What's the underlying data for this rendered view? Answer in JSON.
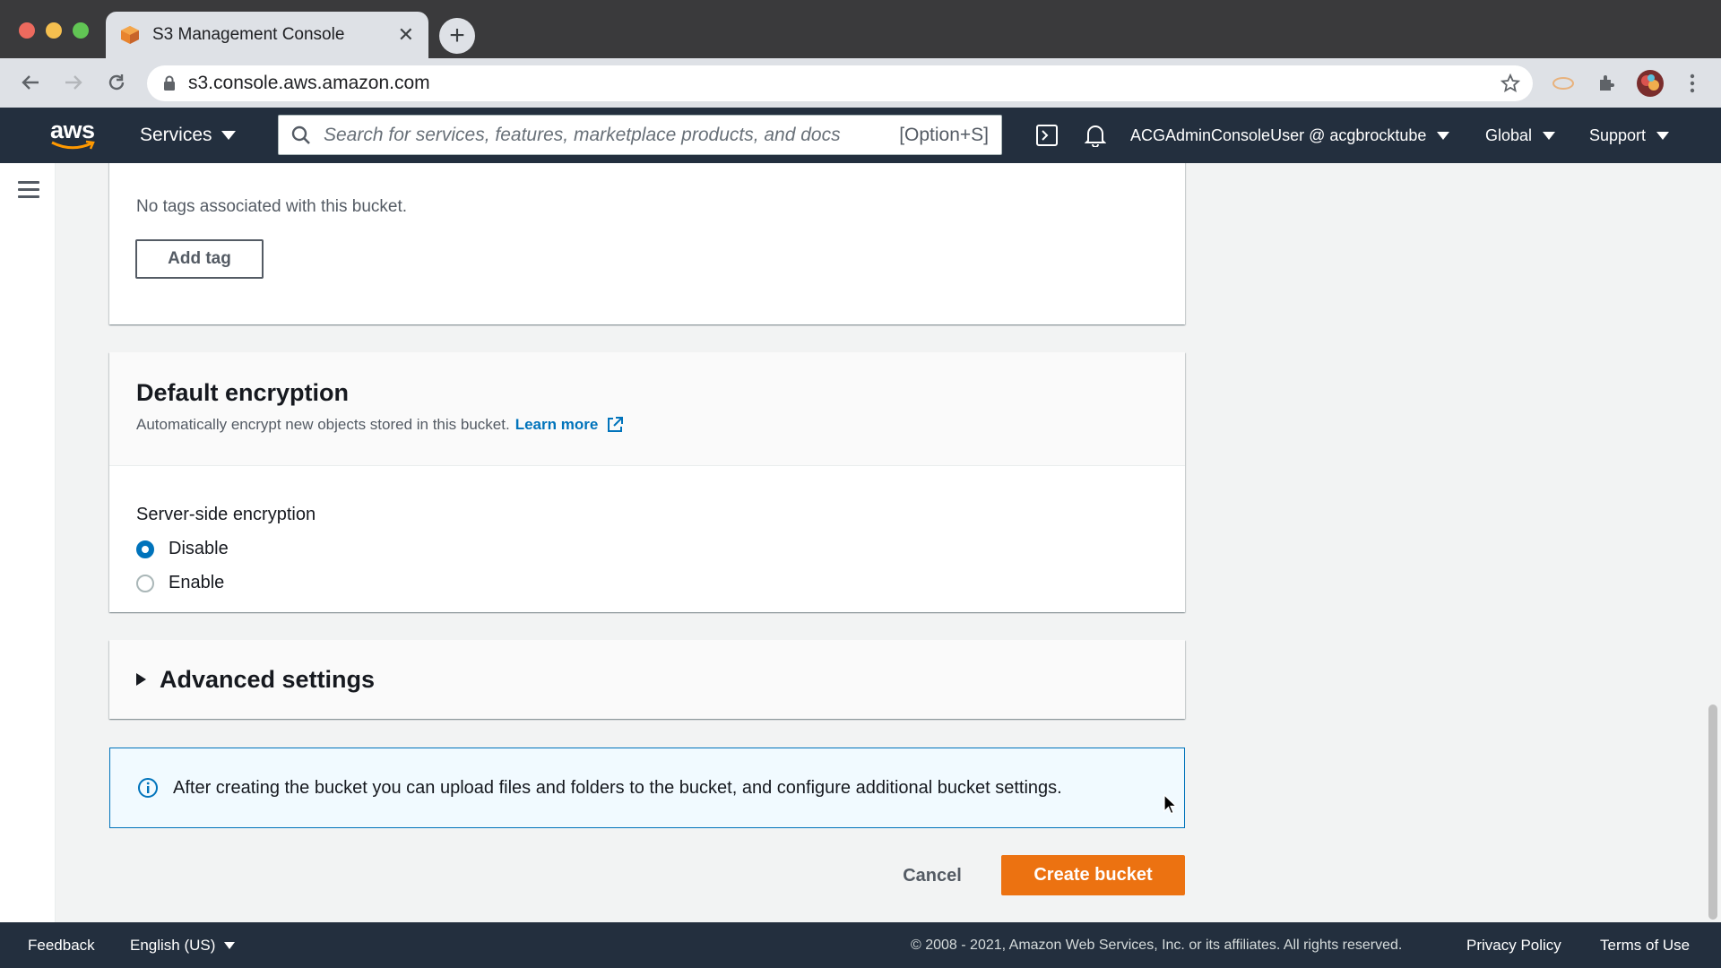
{
  "browser": {
    "tab_title": "S3 Management Console",
    "url": "s3.console.aws.amazon.com"
  },
  "aws_nav": {
    "logo_text": "aws",
    "services_label": "Services",
    "search_placeholder": "Search for services, features, marketplace products, and docs",
    "search_shortcut": "[Option+S]",
    "account_label": "ACGAdminConsoleUser @ acgbrocktube",
    "region_label": "Global",
    "support_label": "Support"
  },
  "tags_section": {
    "empty_text": "No tags associated with this bucket.",
    "add_tag_label": "Add tag"
  },
  "encryption": {
    "title": "Default encryption",
    "description": "Automatically encrypt new objects stored in this bucket.",
    "learn_more": "Learn more",
    "field_label": "Server-side encryption",
    "options": [
      {
        "label": "Disable",
        "checked": true
      },
      {
        "label": "Enable",
        "checked": false
      }
    ]
  },
  "advanced": {
    "label": "Advanced settings"
  },
  "info": {
    "text": "After creating the bucket you can upload files and folders to the bucket, and configure additional bucket settings."
  },
  "actions": {
    "cancel_label": "Cancel",
    "create_label": "Create bucket"
  },
  "footer": {
    "feedback": "Feedback",
    "language": "English (US)",
    "copyright": "© 2008 - 2021, Amazon Web Services, Inc. or its affiliates. All rights reserved.",
    "privacy": "Privacy Policy",
    "terms": "Terms of Use"
  },
  "colors": {
    "aws_nav_bg": "#232f3e",
    "primary_button": "#ec7211",
    "link": "#0073bb",
    "info_bg": "#f1faff"
  }
}
